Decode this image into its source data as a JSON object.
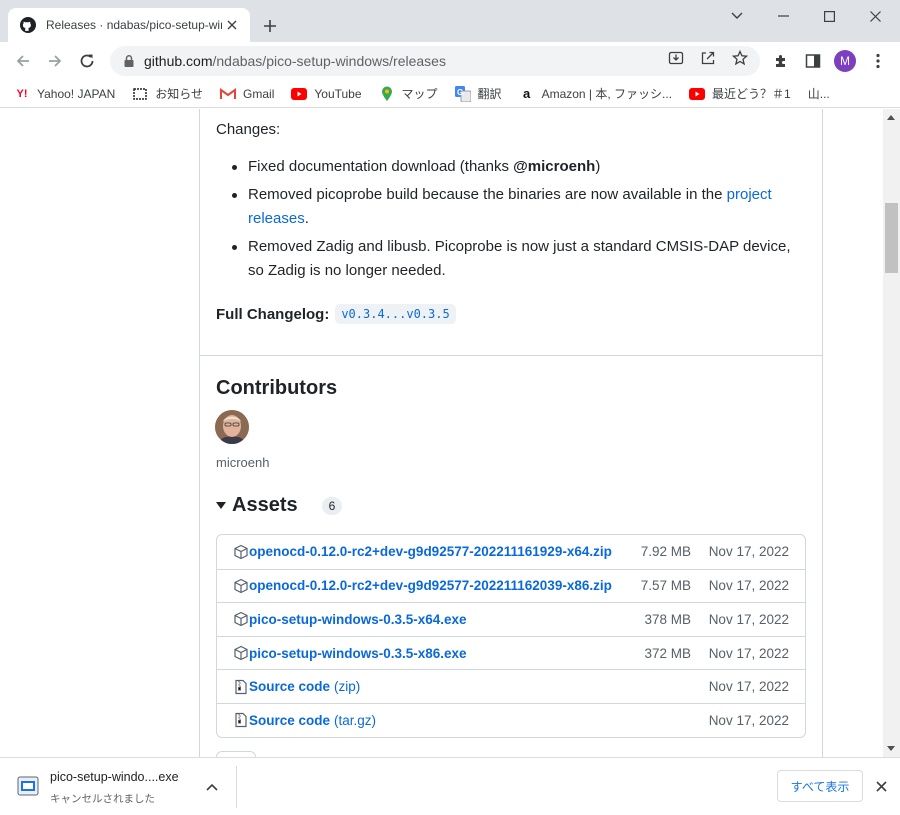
{
  "browser": {
    "tab_title": "Releases · ndabas/pico-setup-windows",
    "url_host": "github.com",
    "url_path": "/ndabas/pico-setup-windows/releases",
    "profile_initial": "M",
    "bookmarks": [
      {
        "label": "Yahoo! JAPAN",
        "icon": "yahoo-icon"
      },
      {
        "label": "お知らせ",
        "icon": "notice-icon"
      },
      {
        "label": "Gmail",
        "icon": "gmail-icon"
      },
      {
        "label": "YouTube",
        "icon": "youtube-icon"
      },
      {
        "label": "マップ",
        "icon": "maps-icon"
      },
      {
        "label": "翻訳",
        "icon": "translate-icon"
      },
      {
        "label": "Amazon | 本, ファッシ...",
        "icon": "amazon-icon"
      },
      {
        "label": "最近どう？＃1",
        "icon": "youtube-icon"
      },
      {
        "label": "山...",
        "icon": ""
      }
    ]
  },
  "release": {
    "changes_label": "Changes:",
    "bullet1_text": "Fixed documentation download (thanks ",
    "bullet1_user": "@microenh",
    "bullet1_end": ")",
    "bullet2_text": "Removed picoprobe build because the binaries are now available in the ",
    "bullet2_link": "project releases",
    "bullet2_end": ".",
    "bullet3_text": "Removed Zadig and libusb. Picoprobe is now just a standard CMSIS-DAP device, so Zadig is no longer needed.",
    "changelog_label": "Full Changelog:",
    "changelog_link": "v0.3.4...v0.3.5",
    "contributors_title": "Contributors",
    "contributor_name": "microenh",
    "assets_title": "Assets",
    "assets_count": "6",
    "assets": [
      {
        "name": "openocd-0.12.0-rc2+dev-g9d92577-202211161929-x64.zip",
        "ext": "",
        "size": "7.92 MB",
        "date": "Nov 17, 2022",
        "icon": "package-icon"
      },
      {
        "name": "openocd-0.12.0-rc2+dev-g9d92577-202211162039-x86.zip",
        "ext": "",
        "size": "7.57 MB",
        "date": "Nov 17, 2022",
        "icon": "package-icon"
      },
      {
        "name": "pico-setup-windows-0.3.5-x64.exe",
        "ext": "",
        "size": "378 MB",
        "date": "Nov 17, 2022",
        "icon": "package-icon"
      },
      {
        "name": "pico-setup-windows-0.3.5-x86.exe",
        "ext": "",
        "size": "372 MB",
        "date": "Nov 17, 2022",
        "icon": "package-icon"
      },
      {
        "name": "Source code",
        "ext": "(zip)",
        "size": "",
        "date": "Nov 17, 2022",
        "icon": "file-zip-icon"
      },
      {
        "name": "Source code",
        "ext": "(tar.gz)",
        "size": "",
        "date": "Nov 17, 2022",
        "icon": "file-zip-icon"
      }
    ]
  },
  "download": {
    "filename": "pico-setup-windo....exe",
    "status": "キャンセルされました",
    "show_all": "すべて表示"
  }
}
